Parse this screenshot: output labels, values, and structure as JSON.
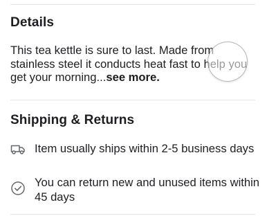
{
  "details": {
    "heading": "Details",
    "description": "This tea kettle is sure to last. Made from stainless steel it conducts heat fast to help you get your morning...",
    "see_more_label": "see more."
  },
  "shipping": {
    "heading": "Shipping & Returns",
    "items": [
      {
        "icon": "truck-icon",
        "text": "Item usually ships within 2-5 business days"
      },
      {
        "icon": "check-circle-icon",
        "text": "You can return new and unused items within 45 days"
      }
    ]
  },
  "colors": {
    "text": "#1c1e21",
    "divider": "#e4e6ea",
    "icon": "#65676b"
  }
}
